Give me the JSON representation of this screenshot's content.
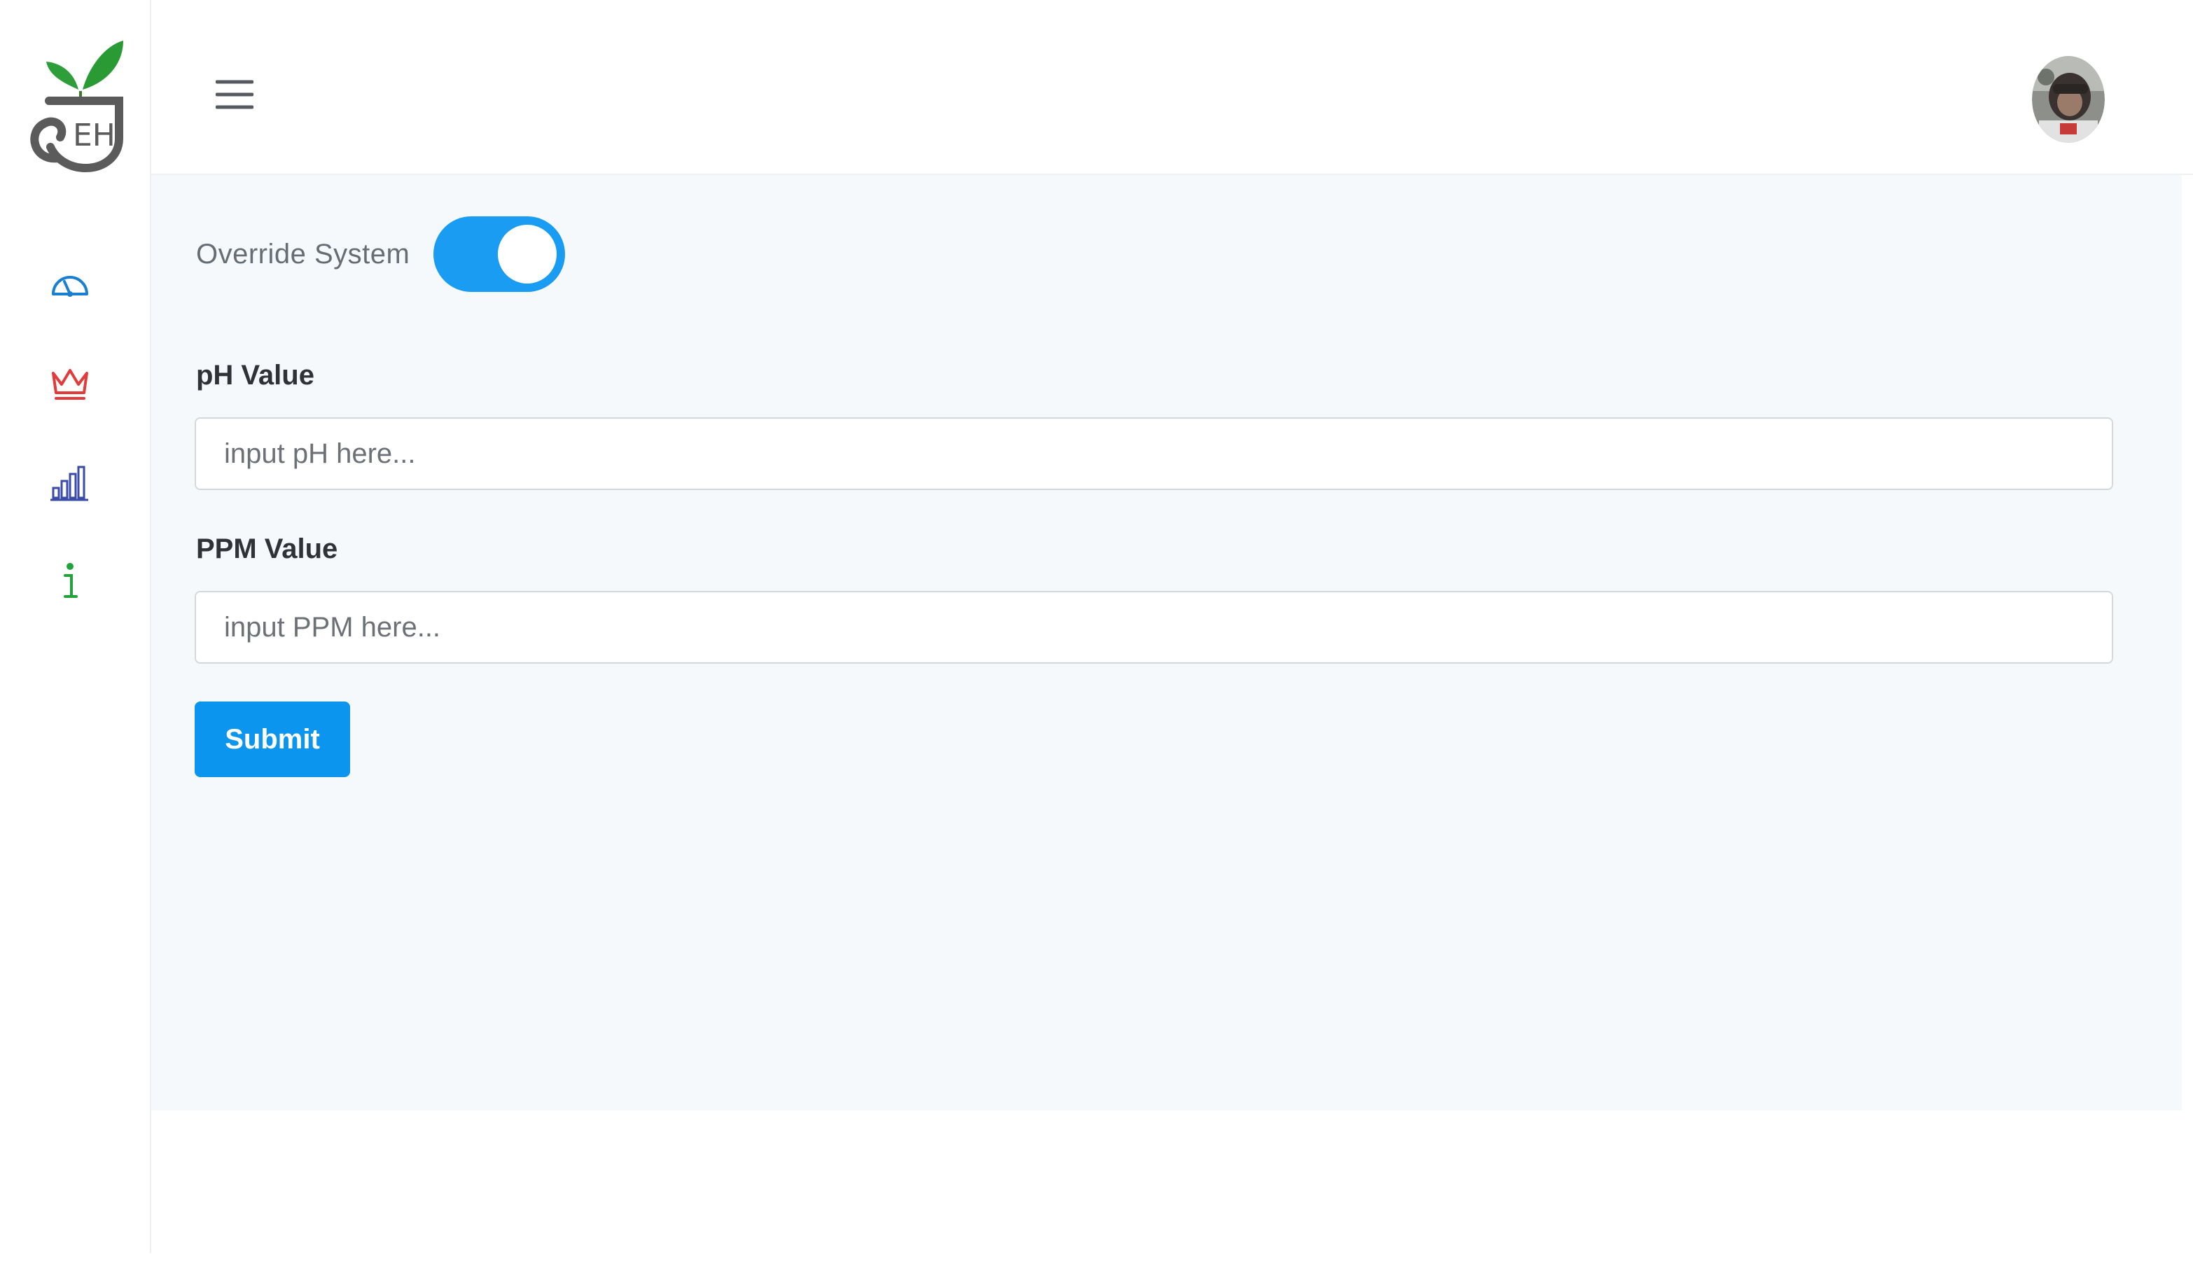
{
  "logo": {
    "text": "EH",
    "icon": "sprout-pot-logo",
    "colors": {
      "leaf": "#2e9e3a",
      "pot": "#5b5b5b"
    }
  },
  "sidebar": {
    "items": [
      {
        "icon": "dashboard-gauge-icon",
        "color": "#1a7fd0"
      },
      {
        "icon": "crown-icon",
        "color": "#e23b3b"
      },
      {
        "icon": "bar-chart-icon",
        "color": "#3b4ba8"
      },
      {
        "icon": "info-icon",
        "color": "#22a33a"
      }
    ]
  },
  "header": {
    "menu_icon": "hamburger-menu-icon",
    "avatar_icon": "user-avatar"
  },
  "override": {
    "label": "Override System",
    "enabled": true,
    "accent_color": "#1a9cf3"
  },
  "form": {
    "ph": {
      "label": "pH Value",
      "placeholder": "input pH here...",
      "value": ""
    },
    "ppm": {
      "label": "PPM Value",
      "placeholder": "input PPM here...",
      "value": ""
    },
    "submit_label": "Submit"
  }
}
